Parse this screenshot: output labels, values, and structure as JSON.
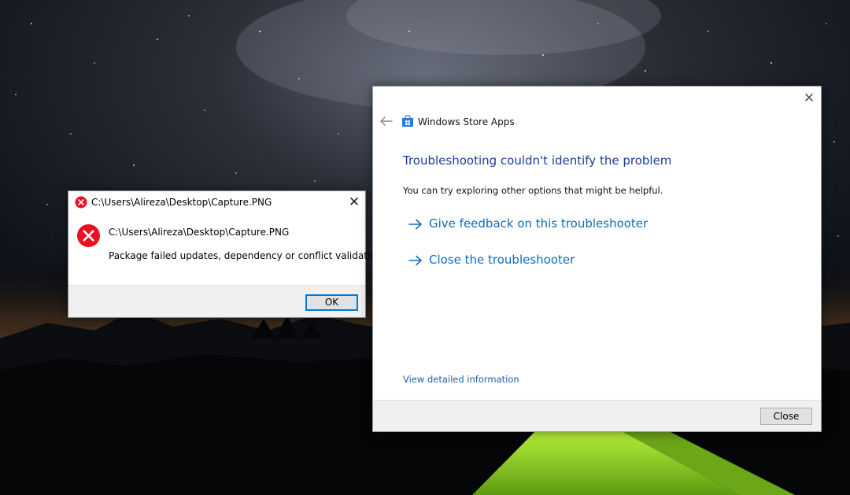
{
  "desktop": {
    "wallpaper": "night-sky-mountains-tent"
  },
  "error_dialog": {
    "title": "C:\\Users\\Alireza\\Desktop\\Capture.PNG",
    "path_text": "C:\\Users\\Alireza\\Desktop\\Capture.PNG",
    "message": "Package failed updates, dependency or conflict validation.",
    "ok_label": "OK",
    "close_glyph": "✕",
    "icon": "error-icon",
    "accent_color": "#e81123"
  },
  "troubleshooter": {
    "app_title": "Windows Store Apps",
    "heading": "Troubleshooting couldn't identify the problem",
    "subtext": "You can try exploring other options that might be helpful.",
    "options": [
      {
        "label": "Give feedback on this troubleshooter",
        "icon": "arrow-right-icon"
      },
      {
        "label": "Close the troubleshooter",
        "icon": "arrow-right-icon"
      }
    ],
    "details_link": "View detailed information",
    "close_button_label": "Close",
    "close_glyph": "✕",
    "heading_color": "#1c3c96",
    "link_color": "#0f6cbd"
  }
}
